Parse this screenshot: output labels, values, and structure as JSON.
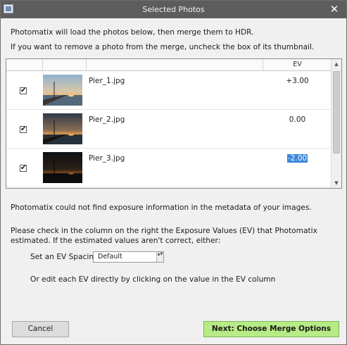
{
  "window": {
    "title": "Selected Photos",
    "close_glyph": "✕",
    "app_icon": "photomatix-icon"
  },
  "intro": {
    "line1": "Photomatix will load the photos below, then merge them to HDR.",
    "line2": "If you want to remove a photo from the merge, uncheck the box of its thumbnail."
  },
  "list": {
    "ev_header": "EV",
    "rows": [
      {
        "checked": true,
        "check_glyph": "✔",
        "filename": "Pier_1.jpg",
        "ev": "+3.00"
      },
      {
        "checked": true,
        "check_glyph": "✔",
        "filename": "Pier_2.jpg",
        "ev": "0.00"
      },
      {
        "checked": true,
        "check_glyph": "✔",
        "filename": "Pier_3.jpg",
        "ev": "-2.00",
        "ev_selected": true
      }
    ],
    "scroll_up_glyph": "▲",
    "scroll_down_glyph": "▼"
  },
  "info": {
    "no_exposure": "Photomatix could not find exposure information in the metadata of your images.",
    "check_line1": "Please check in the column on the right the Exposure Values (EV) that Photomatix",
    "check_line2": "estimated. If the estimated values aren't correct, either:",
    "spacing_label": "Set an EV Spacing:",
    "spacing_value": "Default",
    "spacing_arrows": "▲▼",
    "edit_hint": "Or edit each EV directly by clicking on the value in the EV column"
  },
  "buttons": {
    "cancel": "Cancel",
    "next": "Next: Choose Merge Options"
  },
  "colors": {
    "titlebar": "#5d5d5d",
    "next_button": "#b6eb86",
    "selection": "#3a86d9"
  }
}
